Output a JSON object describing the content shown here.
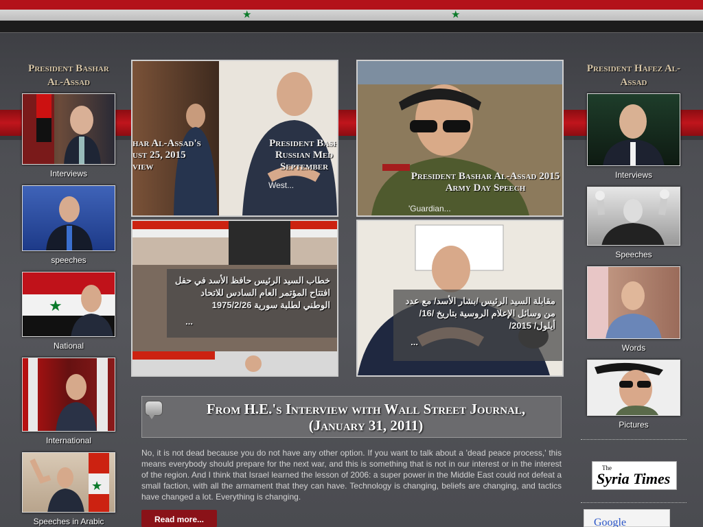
{
  "left_column": {
    "title": "President Bashar Al-Assad",
    "items": [
      {
        "label": "Interviews"
      },
      {
        "label": "speeches"
      },
      {
        "label": "National"
      },
      {
        "label": "International"
      },
      {
        "label": "Speeches in Arabic"
      }
    ]
  },
  "right_column": {
    "title": "President Hafez Al-Assad",
    "items": [
      {
        "label": "Interviews"
      },
      {
        "label": "Speeches"
      },
      {
        "label": "Words"
      },
      {
        "label": "Pictures"
      }
    ]
  },
  "tiles": {
    "t1": {
      "caption_left": "har Al-Assad's ust 25, 2015 view",
      "caption_right": "President Bash Russian Med September",
      "more": "West..."
    },
    "t2": {
      "caption": "President Bashar Al-Assad 2015 Army Day Speech",
      "more": "'Guardian..."
    },
    "t3": {
      "caption": "خطاب السيد الرئيس حافظ الأسد في حفل افتتاح المؤتمر العام السادس للاتحاد الوطني لطلبة سورية 1975/2/26",
      "more": "..."
    },
    "t4": {
      "caption": "مقابلة السيد الرئيس /بشار الأسد/ مع عدد من وسائل الإعلام الروسية بتاريخ /16/ أيلول/ 2015/",
      "more": "..."
    }
  },
  "quote": {
    "title": "From H.E.'s Interview with Wall Street Journal, (January 31, 2011)",
    "text": "No, it is not dead because you do not have any other option. If you want to talk about a 'dead peace process,' this means everybody should prepare for the next war, and this is something that is not in our interest or in the interest of the region. And I think that Israel learned the lesson of 2006: a super power in the Middle East could not defeat a small faction, with all the armament that they can have. Technology is changing, beliefs are changing, and tactics have changed a lot. Everything is changing.",
    "read_more": "Read more..."
  },
  "ads": {
    "syria_times_the": "The",
    "syria_times_name": "Syria Times",
    "google": "Google"
  },
  "colors": {
    "flag_red": "#b3121a",
    "flag_green_star": "#0c7a2a",
    "accent_title": "#d8c7a8",
    "read_more_bg": "#8a1218"
  }
}
